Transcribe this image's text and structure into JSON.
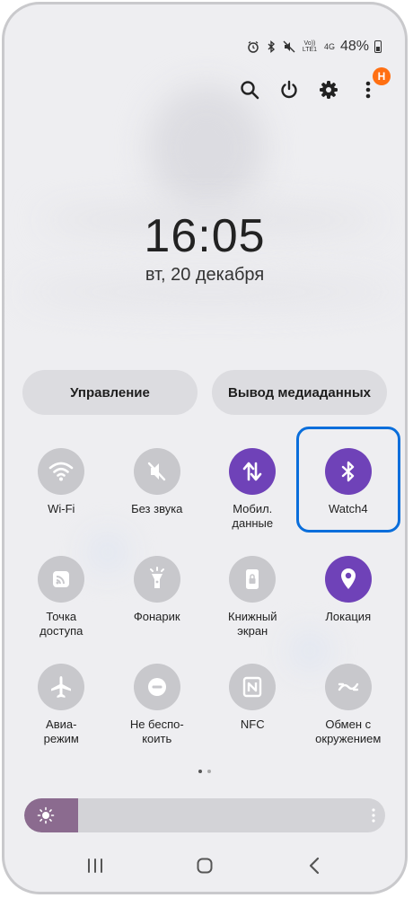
{
  "status_bar": {
    "battery_percent": "48%",
    "volte_label": "Vo)) LTE1",
    "network_label": "4G",
    "icons": [
      "alarm-icon",
      "bluetooth-icon",
      "mute-icon",
      "volte-icon",
      "signal-4g-icon",
      "battery-icon"
    ]
  },
  "top_actions": {
    "icons": [
      "search-icon",
      "power-icon",
      "gear-icon",
      "more-vertical-icon"
    ],
    "badge": "Н"
  },
  "clock": {
    "time": "16:05",
    "date": "вт, 20 декабря"
  },
  "pills": {
    "manage": "Управление",
    "media_output": "Вывод медиаданных"
  },
  "tiles": [
    {
      "label": "Wi-Fi",
      "icon": "wifi-icon",
      "on": false
    },
    {
      "label": "Без звука",
      "icon": "mute-icon",
      "on": false
    },
    {
      "label": "Мобил.\nданные",
      "icon": "mobile-data-icon",
      "on": true
    },
    {
      "label": "Watch4",
      "icon": "bluetooth-icon",
      "on": true
    },
    {
      "label": "Точка\nдоступа",
      "icon": "hotspot-icon",
      "on": false
    },
    {
      "label": "Фонарик",
      "icon": "flashlight-icon",
      "on": false
    },
    {
      "label": "Книжный\nэкран",
      "icon": "portrait-lock-icon",
      "on": false
    },
    {
      "label": "Локация",
      "icon": "location-icon",
      "on": true
    },
    {
      "label": "Авиа-\nрежим",
      "icon": "airplane-icon",
      "on": false
    },
    {
      "label": "Не беспо-\nкоить",
      "icon": "do-not-disturb-icon",
      "on": false
    },
    {
      "label": "NFC",
      "icon": "nfc-icon",
      "on": false
    },
    {
      "label": "Обмен с\nокружением",
      "icon": "nearby-share-icon",
      "on": false
    }
  ],
  "brightness": {
    "level": 0.15
  },
  "nav_bar": {
    "icons": [
      "recents-icon",
      "home-icon",
      "back-icon"
    ]
  },
  "colors": {
    "accent": "#6f42b8",
    "highlight": "#0a6edb",
    "badge": "#ff6f12",
    "tile_off": "#c8c8cc"
  }
}
